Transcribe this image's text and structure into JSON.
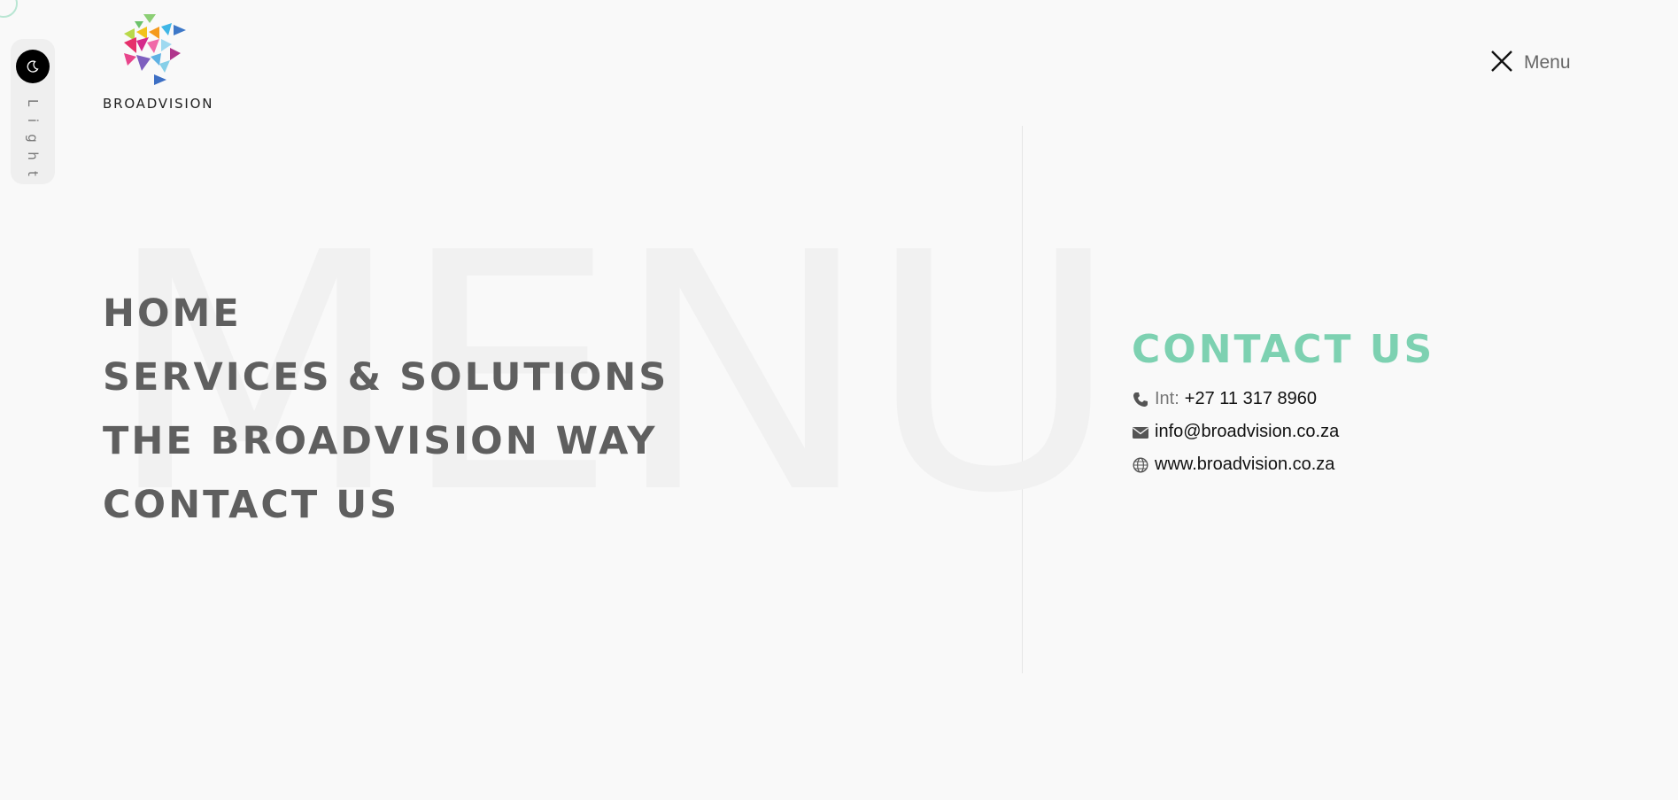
{
  "theme_toggle": {
    "label": "Light",
    "letters": [
      "L",
      "i",
      "g",
      "h",
      "t"
    ]
  },
  "brand": {
    "name": "BROADVISION"
  },
  "header": {
    "menu_label": "Menu"
  },
  "watermark": {
    "text": "MENU"
  },
  "nav": {
    "items": [
      {
        "label": "HOME"
      },
      {
        "label": "SERVICES & SOLUTIONS"
      },
      {
        "label": "THE BROADVISION WAY"
      },
      {
        "label": "CONTACT US"
      }
    ]
  },
  "contact": {
    "title": "CONTACT US",
    "phone_prefix": "Int:",
    "phone": "+27 11 317 8960",
    "email": "info@broadvision.co.za",
    "website": "www.broadvision.co.za"
  },
  "colors": {
    "accent": "#7dd1b1",
    "background": "#f9f9f9",
    "nav_text": "#5f5f5f"
  },
  "icons": [
    "moon-icon",
    "close-icon",
    "phone-icon",
    "mail-icon",
    "globe-icon"
  ]
}
